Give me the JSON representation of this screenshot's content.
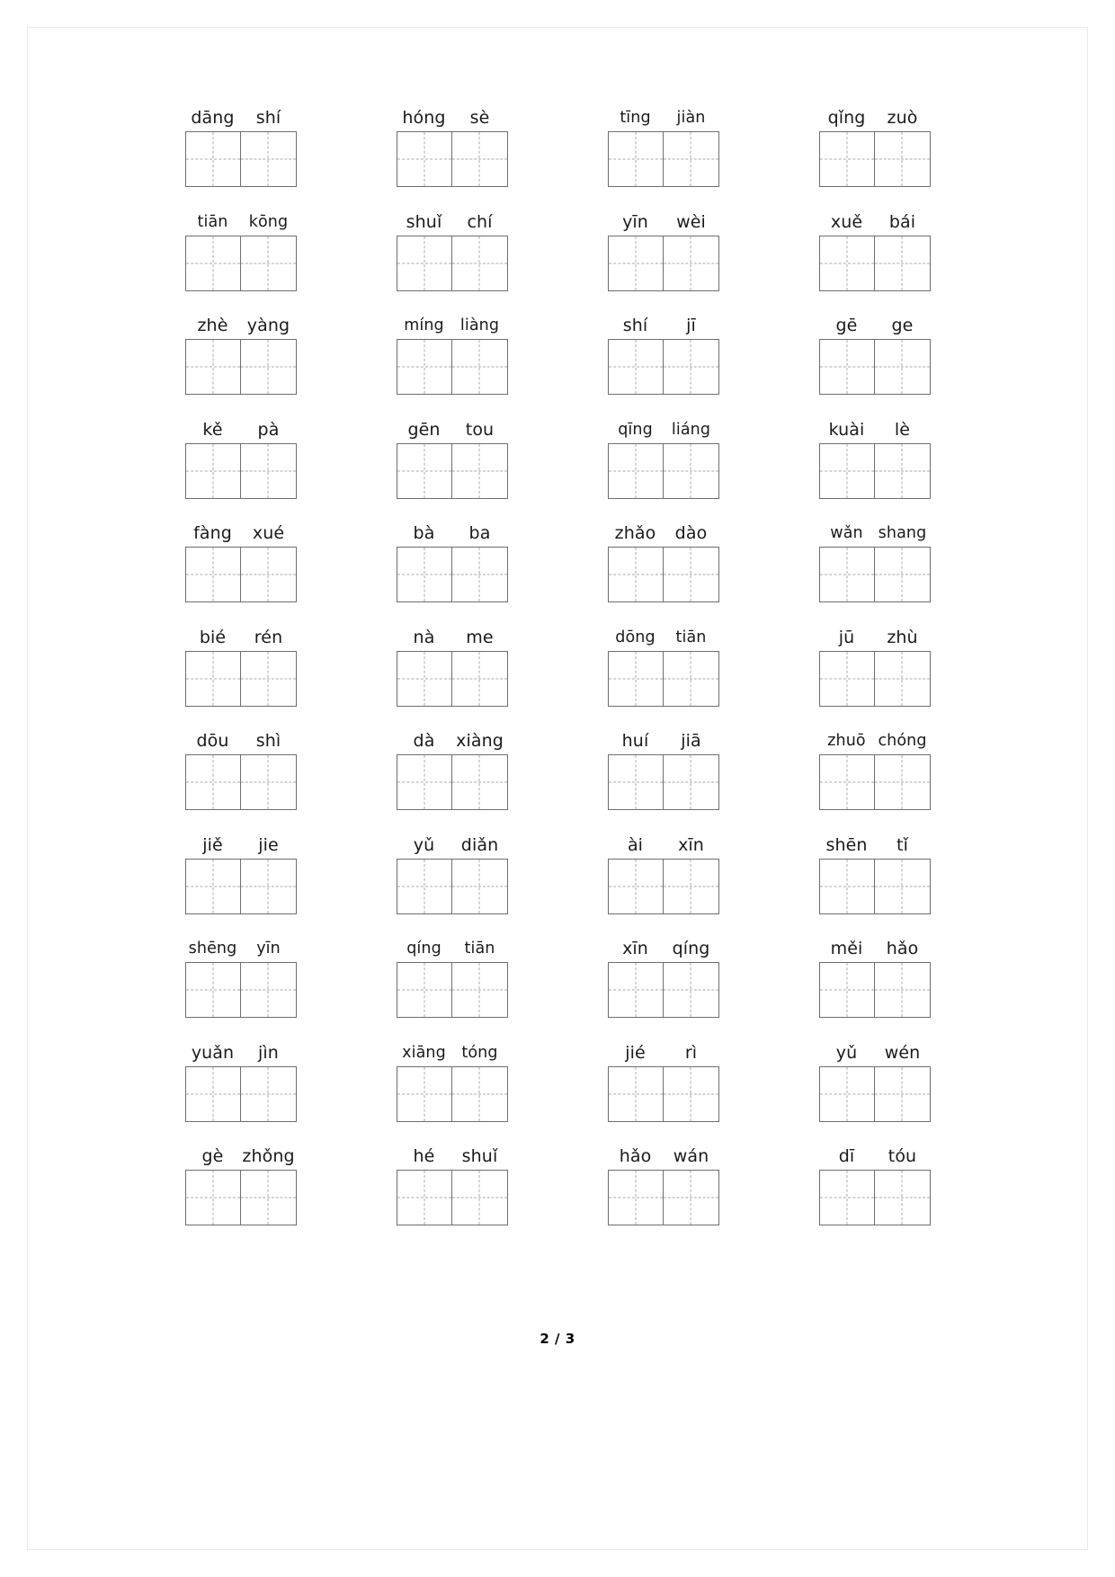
{
  "document": {
    "type": "pinyin-writing-practice-worksheet",
    "footer": "2 / 3",
    "columns": 4,
    "rows": 11,
    "grid_cells_per_word": 2
  },
  "rows": [
    {
      "items": [
        {
          "syllables": [
            "dāng",
            "shí"
          ]
        },
        {
          "syllables": [
            "hóng",
            "sè"
          ]
        },
        {
          "syllables": [
            "tīng",
            "jiàn"
          ]
        },
        {
          "syllables": [
            "qǐng",
            "zuò"
          ]
        }
      ]
    },
    {
      "items": [
        {
          "syllables": [
            "tiān",
            "kōng"
          ]
        },
        {
          "syllables": [
            "shuǐ",
            "chí"
          ]
        },
        {
          "syllables": [
            "yīn",
            "wèi"
          ]
        },
        {
          "syllables": [
            "xuě",
            "bái"
          ]
        }
      ]
    },
    {
      "items": [
        {
          "syllables": [
            "zhè",
            "yàng"
          ]
        },
        {
          "syllables": [
            "míng",
            "liàng"
          ]
        },
        {
          "syllables": [
            "shí",
            "jī"
          ]
        },
        {
          "syllables": [
            "gē",
            "ge"
          ]
        }
      ]
    },
    {
      "items": [
        {
          "syllables": [
            "kě",
            "pà"
          ]
        },
        {
          "syllables": [
            "gēn",
            "tou"
          ]
        },
        {
          "syllables": [
            "qīng",
            "liáng"
          ]
        },
        {
          "syllables": [
            "kuài",
            "lè"
          ]
        }
      ]
    },
    {
      "items": [
        {
          "syllables": [
            "fàng",
            "xué"
          ]
        },
        {
          "syllables": [
            "bà",
            "ba"
          ]
        },
        {
          "syllables": [
            "zhǎo",
            "dào"
          ]
        },
        {
          "syllables": [
            "wǎn",
            "shang"
          ]
        }
      ]
    },
    {
      "items": [
        {
          "syllables": [
            "bié",
            "rén"
          ]
        },
        {
          "syllables": [
            "nà",
            "me"
          ]
        },
        {
          "syllables": [
            "dōng",
            "tiān"
          ]
        },
        {
          "syllables": [
            "jū",
            "zhù"
          ]
        }
      ]
    },
    {
      "items": [
        {
          "syllables": [
            "dōu",
            "shì"
          ]
        },
        {
          "syllables": [
            "dà",
            "xiàng"
          ]
        },
        {
          "syllables": [
            "huí",
            "jiā"
          ]
        },
        {
          "syllables": [
            "zhuō",
            "chóng"
          ]
        }
      ]
    },
    {
      "items": [
        {
          "syllables": [
            "jiě",
            "jie"
          ]
        },
        {
          "syllables": [
            "yǔ",
            "diǎn"
          ]
        },
        {
          "syllables": [
            "ài",
            "xīn"
          ]
        },
        {
          "syllables": [
            "shēn",
            "tǐ"
          ]
        }
      ]
    },
    {
      "items": [
        {
          "syllables": [
            "shēng",
            "yīn"
          ]
        },
        {
          "syllables": [
            "qíng",
            "tiān"
          ]
        },
        {
          "syllables": [
            "xīn",
            "qíng"
          ]
        },
        {
          "syllables": [
            "měi",
            "hǎo"
          ]
        }
      ]
    },
    {
      "items": [
        {
          "syllables": [
            "yuǎn",
            "jìn"
          ]
        },
        {
          "syllables": [
            "xiāng",
            "tóng"
          ]
        },
        {
          "syllables": [
            "jié",
            "rì"
          ]
        },
        {
          "syllables": [
            "yǔ",
            "wén"
          ]
        }
      ]
    },
    {
      "items": [
        {
          "syllables": [
            "gè",
            "zhǒng"
          ]
        },
        {
          "syllables": [
            "hé",
            "shuǐ"
          ]
        },
        {
          "syllables": [
            "hǎo",
            "wán"
          ]
        },
        {
          "syllables": [
            "dī",
            "tóu"
          ]
        }
      ]
    }
  ],
  "colors": {
    "grid_border": "#6e6e6e",
    "grid_guide": "#a9a9a9",
    "text": "#1a1a1a",
    "page_background": "#ffffff"
  }
}
